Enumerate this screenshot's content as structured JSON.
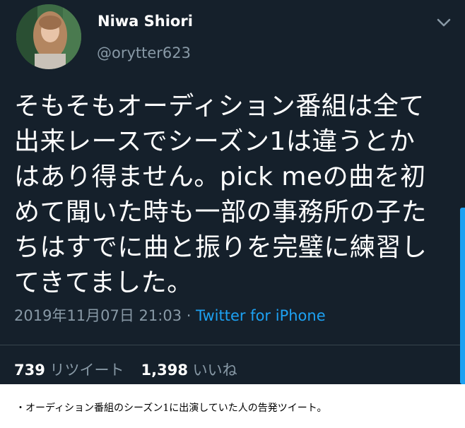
{
  "tweet": {
    "display_name": "Niwa Shiori",
    "handle": "@orytter623",
    "body": "そもそもオーディション番組は全て\n出来レースでシーズン1は違うとか\nはあり得ません。pick meの曲を初\nめて聞いた時も一部の事務所の子た\nちはすでに曲と振りを完璧に練習し\nてきてました。",
    "timestamp": "2019年11月07日 21:03",
    "separator": " · ",
    "source": "Twitter for iPhone",
    "retweet_count": "739",
    "retweet_label": " リツイート",
    "like_count": "1,398",
    "like_label": " いいね",
    "menu_icon": "chevron-down-icon"
  },
  "caption": "・オーディション番組のシーズン1に出演していた人の告発ツイート。",
  "colors": {
    "background": "#15202b",
    "text": "#ffffff",
    "muted": "#8899a6",
    "link": "#1da1f2",
    "divider": "#38444d"
  }
}
